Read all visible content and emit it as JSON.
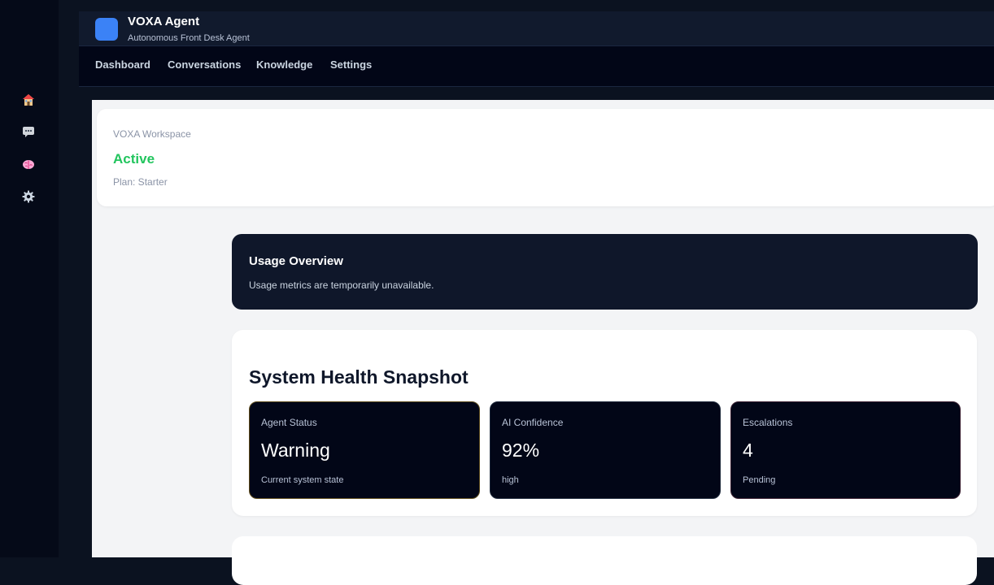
{
  "brand": {
    "title": "VOXA Agent",
    "subtitle": "Autonomous Front Desk Agent",
    "logo_color": "#3b82f6"
  },
  "rail": {
    "icons": [
      "home-icon",
      "chat-icon",
      "brain-icon",
      "gear-icon"
    ]
  },
  "nav": {
    "items": [
      "Dashboard",
      "Conversations",
      "Knowledge",
      "Settings"
    ]
  },
  "workspace": {
    "label": "VOXA Workspace",
    "status": "Active",
    "status_color": "#22c55e",
    "plan": "Plan: Starter"
  },
  "usage": {
    "title": "Usage Overview",
    "message": "Usage metrics are temporarily unavailable."
  },
  "health": {
    "title": "System Health Snapshot",
    "metrics": [
      {
        "label": "Agent Status",
        "value": "Warning",
        "note": "Current system state"
      },
      {
        "label": "AI Confidence",
        "value": "92%",
        "note": "high"
      },
      {
        "label": "Escalations",
        "value": "4",
        "note": "Pending"
      }
    ]
  }
}
